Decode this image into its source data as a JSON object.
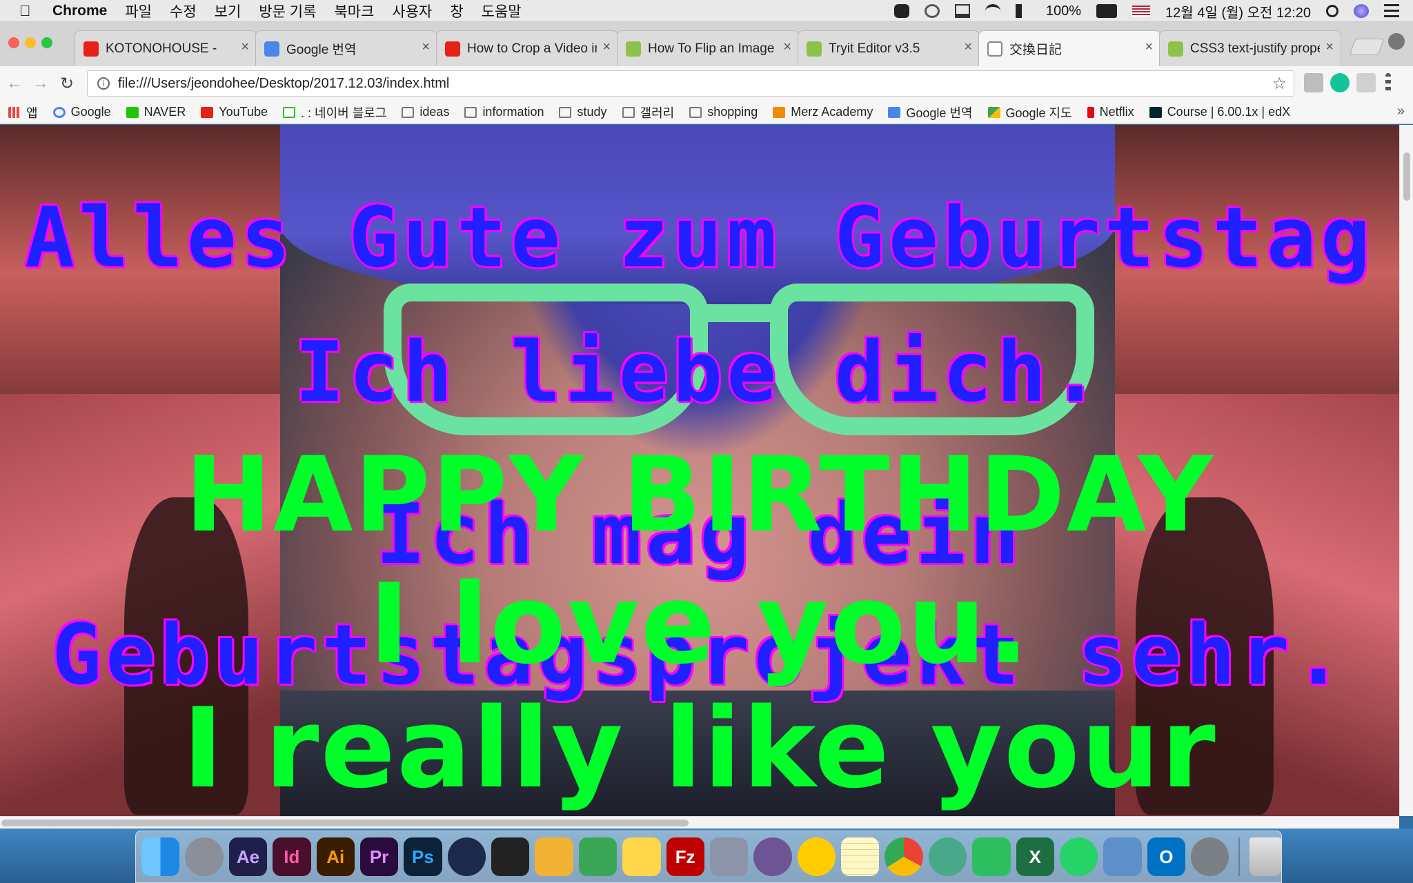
{
  "menubar": {
    "app_name": "Chrome",
    "menus": [
      "파일",
      "수정",
      "보기",
      "방문 기록",
      "북마크",
      "사용자",
      "창",
      "도움말"
    ],
    "battery": "100%",
    "datetime": "12월 4일 (월) 오전 12:20"
  },
  "tabs": [
    {
      "title": "KOTONOHOUSE - ",
      "favicon": "youtube-icon"
    },
    {
      "title": "Google 번역",
      "favicon": "google-translate-icon"
    },
    {
      "title": "How to Crop a Video in",
      "favicon": "youtube-icon"
    },
    {
      "title": "How To Flip an Image",
      "favicon": "w3schools-icon"
    },
    {
      "title": "Tryit Editor v3.5",
      "favicon": "w3schools-icon"
    },
    {
      "title": "交換日記",
      "favicon": "document-icon"
    },
    {
      "title": "CSS3 text-justify prope",
      "favicon": "w3schools-icon"
    }
  ],
  "address_bar": {
    "url": "file:///Users/jeondohee/Desktop/2017.12.03/index.html"
  },
  "bookmarks": [
    {
      "label": "앱",
      "icon": "apps-grid-icon"
    },
    {
      "label": "Google",
      "icon": "google-icon"
    },
    {
      "label": "NAVER",
      "icon": "naver-icon"
    },
    {
      "label": "YouTube",
      "icon": "youtube-icon"
    },
    {
      "label": ". : 네이버 블로그",
      "icon": "naver-blog-icon"
    },
    {
      "label": "ideas",
      "icon": "folder-icon"
    },
    {
      "label": "information",
      "icon": "folder-icon"
    },
    {
      "label": "study",
      "icon": "folder-icon"
    },
    {
      "label": "갤러리",
      "icon": "folder-icon"
    },
    {
      "label": "shopping",
      "icon": "folder-icon"
    },
    {
      "label": "Merz Academy",
      "icon": "merz-icon"
    },
    {
      "label": "Google 번역",
      "icon": "google-translate-icon"
    },
    {
      "label": "Google 지도",
      "icon": "google-maps-icon"
    },
    {
      "label": "Netflix",
      "icon": "netflix-icon"
    },
    {
      "label": "Course | 6.00.1x | edX",
      "icon": "edx-icon"
    }
  ],
  "page": {
    "german_lines": [
      "Alles Gute zum Geburtstag",
      "Ich liebe dich.",
      "Ich mag dein",
      "Geburtstagsprojekt sehr."
    ],
    "english_lines": [
      "HAPPY BIRTHDAY",
      "I love you.",
      "I really like your"
    ],
    "colors": {
      "german_fill": "#2020ff",
      "german_outline": "#ff00ff",
      "english_fill": "#00ff2a"
    }
  },
  "dock": {
    "apps": [
      "Finder",
      "Launchpad",
      "Ae",
      "Id",
      "Ai",
      "Pr",
      "Ps",
      "Cinema 4D",
      "Unity",
      "Cocktail",
      "Instruments",
      "Python",
      "FileZilla",
      "Sequel Pro",
      "GitHub",
      "Cyberduck",
      "Notes",
      "Chrome",
      "Atom",
      "Evernote",
      "Excel",
      "WhatsApp",
      "Preview",
      "Outlook",
      "System Preferences",
      "Trash"
    ]
  }
}
